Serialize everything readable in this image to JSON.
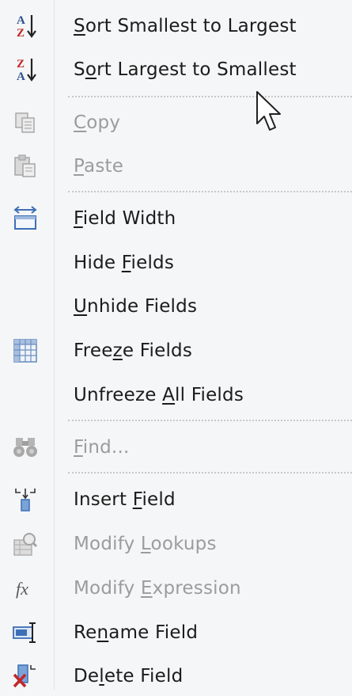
{
  "menu": {
    "items": [
      {
        "id": "sort-asc",
        "pre": "",
        "key": "S",
        "post": "ort Smallest to Largest",
        "enabled": true,
        "icon": "sort-ascending-icon"
      },
      {
        "id": "sort-desc",
        "pre": "S",
        "key": "o",
        "post": "rt Largest to Smallest",
        "enabled": true,
        "icon": "sort-descending-icon"
      },
      {
        "id": "copy",
        "pre": "",
        "key": "C",
        "post": "opy",
        "enabled": false,
        "icon": "copy-icon"
      },
      {
        "id": "paste",
        "pre": "",
        "key": "P",
        "post": "aste",
        "enabled": false,
        "icon": "paste-icon"
      },
      {
        "id": "field-width",
        "pre": "",
        "key": "F",
        "post": "ield Width",
        "enabled": true,
        "icon": "field-width-icon"
      },
      {
        "id": "hide-fields",
        "pre": "Hide ",
        "key": "F",
        "post": "ields",
        "enabled": true,
        "icon": ""
      },
      {
        "id": "unhide-fields",
        "pre": "",
        "key": "U",
        "post": "nhide Fields",
        "enabled": true,
        "icon": ""
      },
      {
        "id": "freeze-fields",
        "pre": "Free",
        "key": "z",
        "post": "e Fields",
        "enabled": true,
        "icon": "freeze-grid-icon"
      },
      {
        "id": "unfreeze-all",
        "pre": "Unfreeze ",
        "key": "A",
        "post": "ll Fields",
        "enabled": true,
        "icon": ""
      },
      {
        "id": "find",
        "pre": "",
        "key": "F",
        "post": "ind...",
        "enabled": false,
        "icon": "binoculars-icon"
      },
      {
        "id": "insert-field",
        "pre": "Insert ",
        "key": "F",
        "post": "ield",
        "enabled": true,
        "icon": "insert-field-icon"
      },
      {
        "id": "modify-lookups",
        "pre": "Modify ",
        "key": "L",
        "post": "ookups",
        "enabled": false,
        "icon": "lookup-icon"
      },
      {
        "id": "modify-expression",
        "pre": "Modify ",
        "key": "E",
        "post": "xpression",
        "enabled": false,
        "icon": "function-icon"
      },
      {
        "id": "rename-field",
        "pre": "Re",
        "key": "n",
        "post": "ame Field",
        "enabled": true,
        "icon": "rename-icon"
      },
      {
        "id": "delete-field",
        "pre": "De",
        "key": "l",
        "post": "ete Field",
        "enabled": true,
        "icon": "delete-field-icon"
      }
    ],
    "sort_asc_glyph_top": "A",
    "sort_asc_glyph_bottom": "Z",
    "sort_desc_glyph_top": "Z",
    "sort_desc_glyph_bottom": "A",
    "fx_glyph": "fx"
  },
  "colors": {
    "menu_bg": "#f5f6f7",
    "text_enabled": "#1b1b1b",
    "text_disabled": "#9c9c9c",
    "separator": "#c8c8c8",
    "icon_blue": "#3d6fb6",
    "icon_red": "#c0282b"
  }
}
